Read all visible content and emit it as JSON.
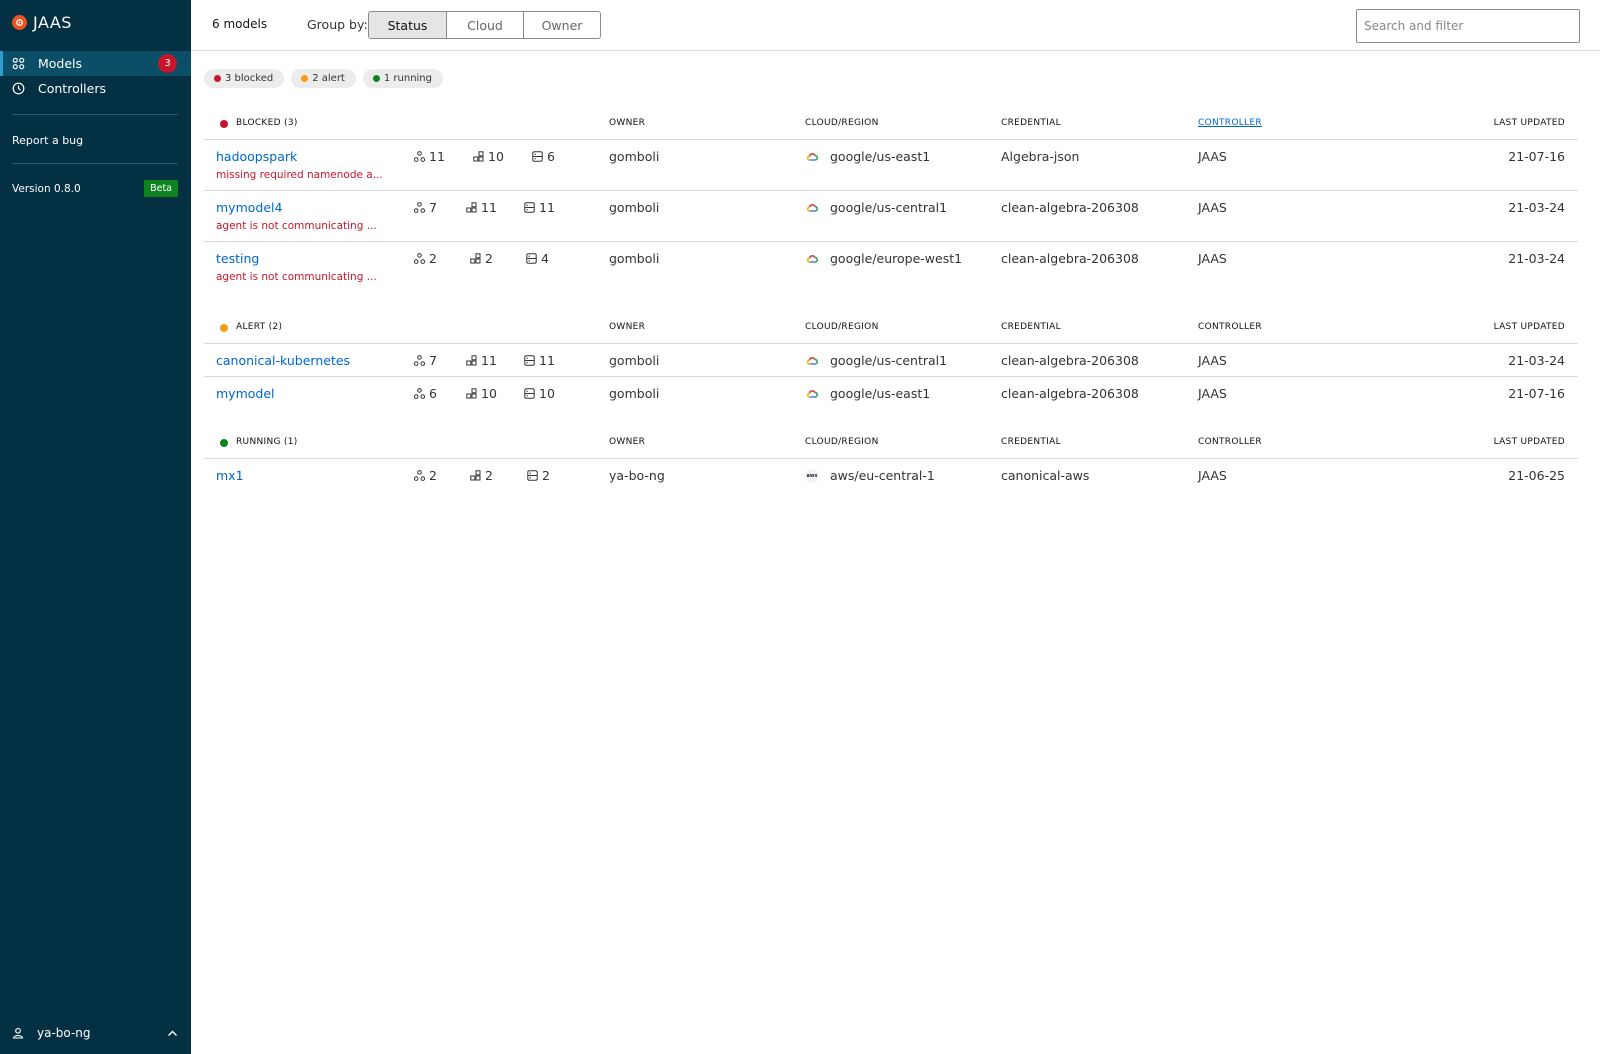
{
  "app": {
    "title": "JAAS"
  },
  "sidebar": {
    "nav": [
      {
        "label": "Models",
        "icon": "models-icon",
        "badge": "3",
        "active": true
      },
      {
        "label": "Controllers",
        "icon": "controllers-icon"
      }
    ],
    "report_bug": "Report a bug",
    "version": "Version 0.8.0",
    "beta": "Beta",
    "user": "ya-bo-ng"
  },
  "header": {
    "count": "6 models",
    "group_by_label": "Group by:",
    "group_options": [
      "Status",
      "Cloud",
      "Owner"
    ],
    "selected_group": "Status",
    "search_placeholder": "Search and filter"
  },
  "summary": [
    {
      "label": "3 blocked",
      "color": "#c7162b"
    },
    {
      "label": "2 alert",
      "color": "#f99b11"
    },
    {
      "label": "1 running",
      "color": "#0e8420"
    }
  ],
  "columns": {
    "owner": "OWNER",
    "cloud": "CLOUD/REGION",
    "credential": "CREDENTIAL",
    "controller": "CONTROLLER",
    "updated": "LAST UPDATED"
  },
  "groups": [
    {
      "title": "BLOCKED (3)",
      "color": "#c7162b",
      "models": [
        {
          "name": "hadoopspark",
          "message": "missing required namenode a...",
          "apps": "11",
          "units": "10",
          "machines": "6",
          "owner": "gomboli",
          "cloud": "google/us-east1",
          "provider": "google",
          "credential": "Algebra-json",
          "controller": "JAAS",
          "updated": "21-07-16"
        },
        {
          "name": "mymodel4",
          "message": "agent is not communicating ...",
          "apps": "7",
          "units": "11",
          "machines": "11",
          "owner": "gomboli",
          "cloud": "google/us-central1",
          "provider": "google",
          "credential": "clean-algebra-206308",
          "controller": "JAAS",
          "updated": "21-03-24"
        },
        {
          "name": "testing",
          "message": "agent is not communicating ...",
          "apps": "2",
          "units": "2",
          "machines": "4",
          "owner": "gomboli",
          "cloud": "google/europe-west1",
          "provider": "google",
          "credential": "clean-algebra-206308",
          "controller": "JAAS",
          "updated": "21-03-24"
        }
      ]
    },
    {
      "title": "ALERT (2)",
      "color": "#f99b11",
      "models": [
        {
          "name": "canonical-kubernetes",
          "apps": "7",
          "units": "11",
          "machines": "11",
          "owner": "gomboli",
          "cloud": "google/us-central1",
          "provider": "google",
          "credential": "clean-algebra-206308",
          "controller": "JAAS",
          "updated": "21-03-24"
        },
        {
          "name": "mymodel",
          "apps": "6",
          "units": "10",
          "machines": "10",
          "owner": "gomboli",
          "cloud": "google/us-east1",
          "provider": "google",
          "credential": "clean-algebra-206308",
          "controller": "JAAS",
          "updated": "21-07-16"
        }
      ]
    },
    {
      "title": "RUNNING (1)",
      "color": "#0e8420",
      "models": [
        {
          "name": "mx1",
          "apps": "2",
          "units": "2",
          "machines": "2",
          "owner": "ya-bo-ng",
          "cloud": "aws/eu-central-1",
          "provider": "aws",
          "credential": "canonical-aws",
          "controller": "JAAS",
          "updated": "21-06-25"
        }
      ]
    }
  ]
}
